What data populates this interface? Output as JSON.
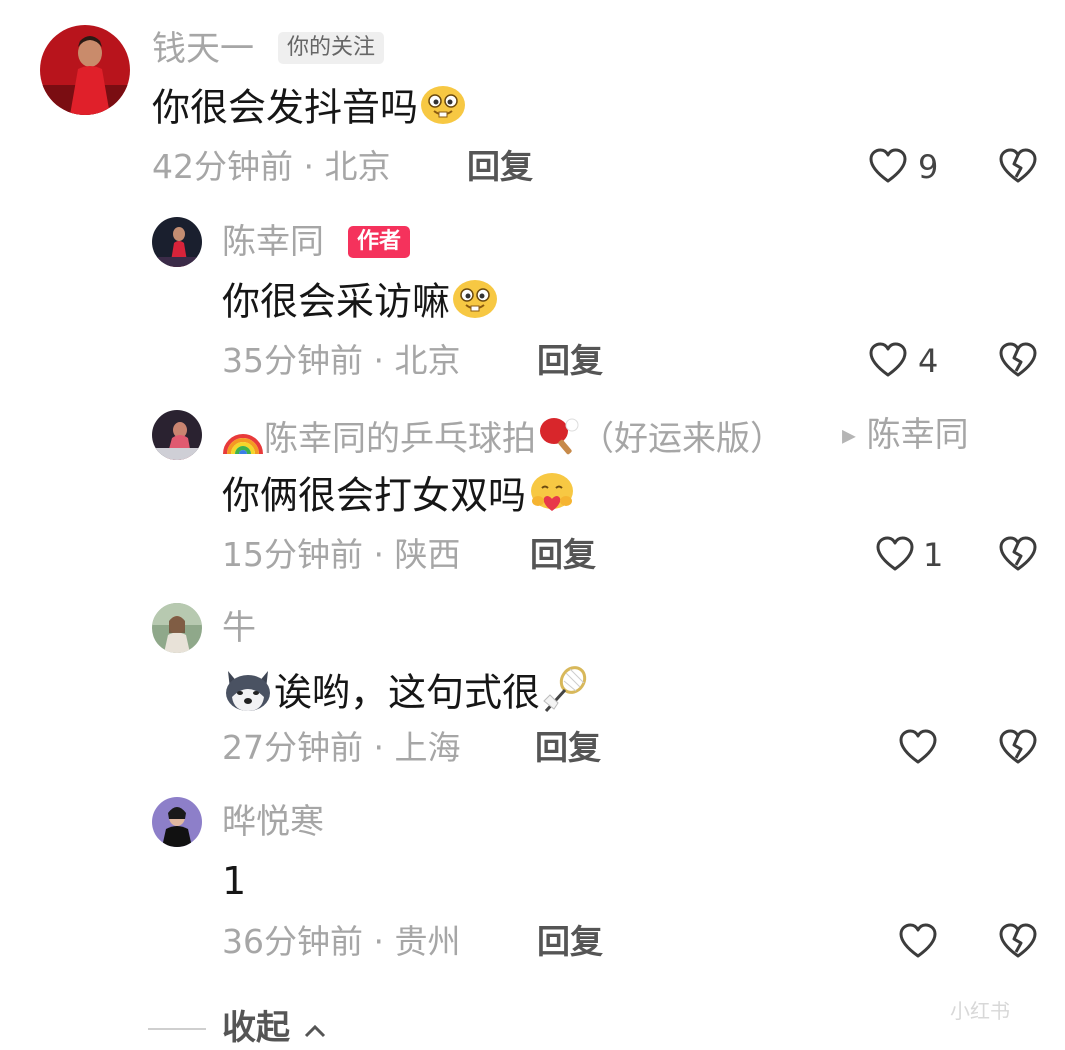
{
  "comments": [
    {
      "user": "钱天一",
      "tag": "你的关注",
      "text": "你很会发抖音吗",
      "time_location": "42分钟前 · 北京",
      "reply_label": "回复",
      "likes": "9"
    },
    {
      "user": "陈幸同",
      "tag": "作者",
      "text": "你很会采访嘛",
      "time_location": "35分钟前 · 北京",
      "reply_label": "回复",
      "likes": "4"
    },
    {
      "user": "陈幸同的乒乓球拍",
      "user_suffix": "（好运来版）",
      "reply_to": "陈幸同",
      "text": "你俩很会打女双吗",
      "time_location": "15分钟前 · 陕西",
      "reply_label": "回复",
      "likes": "1"
    },
    {
      "user": "牛",
      "text": "诶哟，这句式很",
      "time_location": "27分钟前 · 上海",
      "reply_label": "回复",
      "likes": ""
    },
    {
      "user": "晔悦寒",
      "text": "1",
      "time_location": "36分钟前 · 贵州",
      "reply_label": "回复",
      "likes": ""
    }
  ],
  "collapse_label": "收起",
  "watermark": "小红书",
  "colors": {
    "author_tag": "#f5325c",
    "meta": "#a6a6a6"
  },
  "icons": [
    "heart-outline-icon",
    "broken-heart-icon",
    "rainbow-emoji-icon",
    "ping-pong-emoji-icon",
    "badminton-emoji-icon",
    "grin-emoji-icon",
    "hug-emoji-icon",
    "husky-emoji-icon",
    "chevron-up-icon"
  ]
}
